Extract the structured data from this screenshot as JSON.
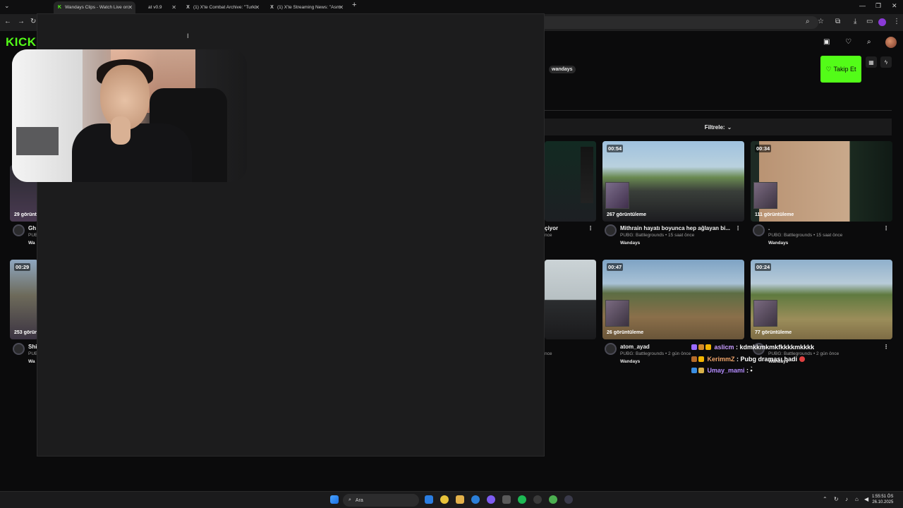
{
  "browser": {
    "tabs": [
      {
        "title": "Wandays Clips - Watch Live on",
        "active": true
      },
      {
        "title": "at v0.9",
        "active": false
      },
      {
        "title": "(1) X'te Combat Archive: \"Turki",
        "active": false
      },
      {
        "title": "(1) X'te Streaming News: \"Asm",
        "active": false
      }
    ],
    "new_tab": "+"
  },
  "kick": {
    "logo": "KICK",
    "channel_tag": "wandays",
    "follow_label": "Takip Et",
    "filter_label": "Filtrele:"
  },
  "clips": [
    {
      "id": "a",
      "duration": "",
      "views": "",
      "title": "çiyor",
      "subtitle": "nce",
      "channel": ""
    },
    {
      "id": "b",
      "duration": "00:54",
      "views": "267 görüntüleme",
      "title": "Mithrain hayatı boyunca hep ağlayan bi...",
      "subtitle": "PUBG: Battlegrounds • 15 saat önce",
      "channel": "Wandays"
    },
    {
      "id": "c",
      "duration": "00:34",
      "views": "111 görüntüleme",
      "title": ".",
      "subtitle": "PUBG: Battlegrounds • 15 saat önce",
      "channel": "Wandays"
    },
    {
      "id": "d",
      "duration": "",
      "views": "",
      "title": "",
      "subtitle": "nce",
      "channel": ""
    },
    {
      "id": "e",
      "duration": "00:47",
      "views": "26 görüntüleme",
      "title": "atom_ayad",
      "subtitle": "PUBG: Battlegrounds • 2 gün önce",
      "channel": "Wandays"
    },
    {
      "id": "f",
      "duration": "00:24",
      "views": "77 görüntüleme",
      "title": "",
      "subtitle": "PUBG: Battlegrounds • 2 gün önce",
      "channel": "Wandays"
    },
    {
      "id": "g",
      "duration": "",
      "views": "29 görünt",
      "title": "Gh",
      "subtitle": "PUB",
      "channel": "Wa"
    },
    {
      "id": "h",
      "duration": "00:29",
      "views": "253 görün",
      "title": "Shi",
      "subtitle": "PUB",
      "channel": "Wa"
    }
  ],
  "chat": [
    {
      "user": "aslicm",
      "sep": " : ",
      "message": "kdmkkmkmkfkkkkmkkkk",
      "user_color": "#c79cff"
    },
    {
      "user": "KerimmZ",
      "sep": " : ",
      "message": "Pubg draması hadi",
      "user_color": "#f0a46a"
    },
    {
      "user": "Umay_mami",
      "sep": " : ",
      "message": "",
      "user_color": "#b48cff"
    }
  ],
  "taskbar": {
    "search_placeholder": "Ara",
    "time": "1:55:51 ÖS",
    "date": "26.10.2025"
  },
  "colors": {
    "kick_green": "#53fc18",
    "page_bg": "#0b0b0c",
    "panel_bg": "#1c1c1d"
  }
}
